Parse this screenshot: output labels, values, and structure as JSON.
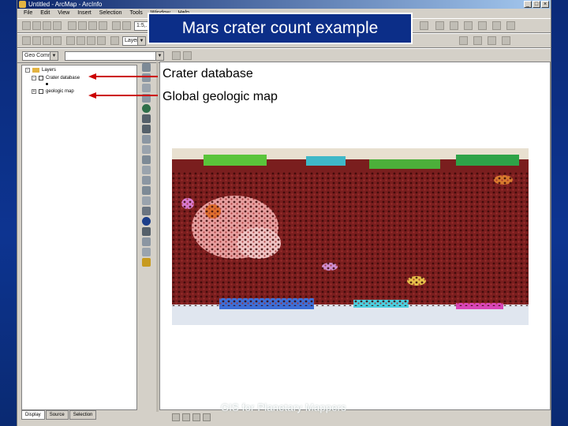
{
  "slide": {
    "title": "Mars crater count example",
    "labels": [
      "Crater database",
      "Global geologic map"
    ],
    "footer": "GIS for Planetary Mappers"
  },
  "window": {
    "title": "Untitled - ArcMap - ArcInfo",
    "menu": [
      "File",
      "Edit",
      "View",
      "Insert",
      "Selection",
      "Tools",
      "Window",
      "Help"
    ]
  },
  "toolbar": {
    "scale": "1:5,...",
    "layer": "Layers",
    "tool_combo": "Geo Comm..."
  },
  "toc": {
    "root": "Layers",
    "items": [
      "Crater database",
      "geologic map"
    ],
    "tabs": [
      "Display",
      "Source",
      "Selection"
    ]
  },
  "colors": {
    "slide_bg": "#0b2a78",
    "callout_bg": "#0c2e88",
    "arrow": "#cc0000",
    "crater_dots": "#8b1a1a"
  }
}
